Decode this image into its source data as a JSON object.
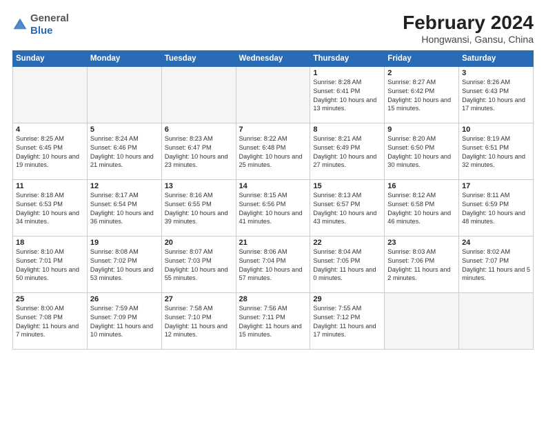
{
  "logo": {
    "general": "General",
    "blue": "Blue"
  },
  "header": {
    "month_year": "February 2024",
    "location": "Hongwansi, Gansu, China"
  },
  "weekdays": [
    "Sunday",
    "Monday",
    "Tuesday",
    "Wednesday",
    "Thursday",
    "Friday",
    "Saturday"
  ],
  "weeks": [
    [
      {
        "day": "",
        "detail": ""
      },
      {
        "day": "",
        "detail": ""
      },
      {
        "day": "",
        "detail": ""
      },
      {
        "day": "",
        "detail": ""
      },
      {
        "day": "1",
        "detail": "Sunrise: 8:28 AM\nSunset: 6:41 PM\nDaylight: 10 hours\nand 13 minutes."
      },
      {
        "day": "2",
        "detail": "Sunrise: 8:27 AM\nSunset: 6:42 PM\nDaylight: 10 hours\nand 15 minutes."
      },
      {
        "day": "3",
        "detail": "Sunrise: 8:26 AM\nSunset: 6:43 PM\nDaylight: 10 hours\nand 17 minutes."
      }
    ],
    [
      {
        "day": "4",
        "detail": "Sunrise: 8:25 AM\nSunset: 6:45 PM\nDaylight: 10 hours\nand 19 minutes."
      },
      {
        "day": "5",
        "detail": "Sunrise: 8:24 AM\nSunset: 6:46 PM\nDaylight: 10 hours\nand 21 minutes."
      },
      {
        "day": "6",
        "detail": "Sunrise: 8:23 AM\nSunset: 6:47 PM\nDaylight: 10 hours\nand 23 minutes."
      },
      {
        "day": "7",
        "detail": "Sunrise: 8:22 AM\nSunset: 6:48 PM\nDaylight: 10 hours\nand 25 minutes."
      },
      {
        "day": "8",
        "detail": "Sunrise: 8:21 AM\nSunset: 6:49 PM\nDaylight: 10 hours\nand 27 minutes."
      },
      {
        "day": "9",
        "detail": "Sunrise: 8:20 AM\nSunset: 6:50 PM\nDaylight: 10 hours\nand 30 minutes."
      },
      {
        "day": "10",
        "detail": "Sunrise: 8:19 AM\nSunset: 6:51 PM\nDaylight: 10 hours\nand 32 minutes."
      }
    ],
    [
      {
        "day": "11",
        "detail": "Sunrise: 8:18 AM\nSunset: 6:53 PM\nDaylight: 10 hours\nand 34 minutes."
      },
      {
        "day": "12",
        "detail": "Sunrise: 8:17 AM\nSunset: 6:54 PM\nDaylight: 10 hours\nand 36 minutes."
      },
      {
        "day": "13",
        "detail": "Sunrise: 8:16 AM\nSunset: 6:55 PM\nDaylight: 10 hours\nand 39 minutes."
      },
      {
        "day": "14",
        "detail": "Sunrise: 8:15 AM\nSunset: 6:56 PM\nDaylight: 10 hours\nand 41 minutes."
      },
      {
        "day": "15",
        "detail": "Sunrise: 8:13 AM\nSunset: 6:57 PM\nDaylight: 10 hours\nand 43 minutes."
      },
      {
        "day": "16",
        "detail": "Sunrise: 8:12 AM\nSunset: 6:58 PM\nDaylight: 10 hours\nand 46 minutes."
      },
      {
        "day": "17",
        "detail": "Sunrise: 8:11 AM\nSunset: 6:59 PM\nDaylight: 10 hours\nand 48 minutes."
      }
    ],
    [
      {
        "day": "18",
        "detail": "Sunrise: 8:10 AM\nSunset: 7:01 PM\nDaylight: 10 hours\nand 50 minutes."
      },
      {
        "day": "19",
        "detail": "Sunrise: 8:08 AM\nSunset: 7:02 PM\nDaylight: 10 hours\nand 53 minutes."
      },
      {
        "day": "20",
        "detail": "Sunrise: 8:07 AM\nSunset: 7:03 PM\nDaylight: 10 hours\nand 55 minutes."
      },
      {
        "day": "21",
        "detail": "Sunrise: 8:06 AM\nSunset: 7:04 PM\nDaylight: 10 hours\nand 57 minutes."
      },
      {
        "day": "22",
        "detail": "Sunrise: 8:04 AM\nSunset: 7:05 PM\nDaylight: 11 hours\nand 0 minutes."
      },
      {
        "day": "23",
        "detail": "Sunrise: 8:03 AM\nSunset: 7:06 PM\nDaylight: 11 hours\nand 2 minutes."
      },
      {
        "day": "24",
        "detail": "Sunrise: 8:02 AM\nSunset: 7:07 PM\nDaylight: 11 hours\nand 5 minutes."
      }
    ],
    [
      {
        "day": "25",
        "detail": "Sunrise: 8:00 AM\nSunset: 7:08 PM\nDaylight: 11 hours\nand 7 minutes."
      },
      {
        "day": "26",
        "detail": "Sunrise: 7:59 AM\nSunset: 7:09 PM\nDaylight: 11 hours\nand 10 minutes."
      },
      {
        "day": "27",
        "detail": "Sunrise: 7:58 AM\nSunset: 7:10 PM\nDaylight: 11 hours\nand 12 minutes."
      },
      {
        "day": "28",
        "detail": "Sunrise: 7:56 AM\nSunset: 7:11 PM\nDaylight: 11 hours\nand 15 minutes."
      },
      {
        "day": "29",
        "detail": "Sunrise: 7:55 AM\nSunset: 7:12 PM\nDaylight: 11 hours\nand 17 minutes."
      },
      {
        "day": "",
        "detail": ""
      },
      {
        "day": "",
        "detail": ""
      }
    ]
  ]
}
